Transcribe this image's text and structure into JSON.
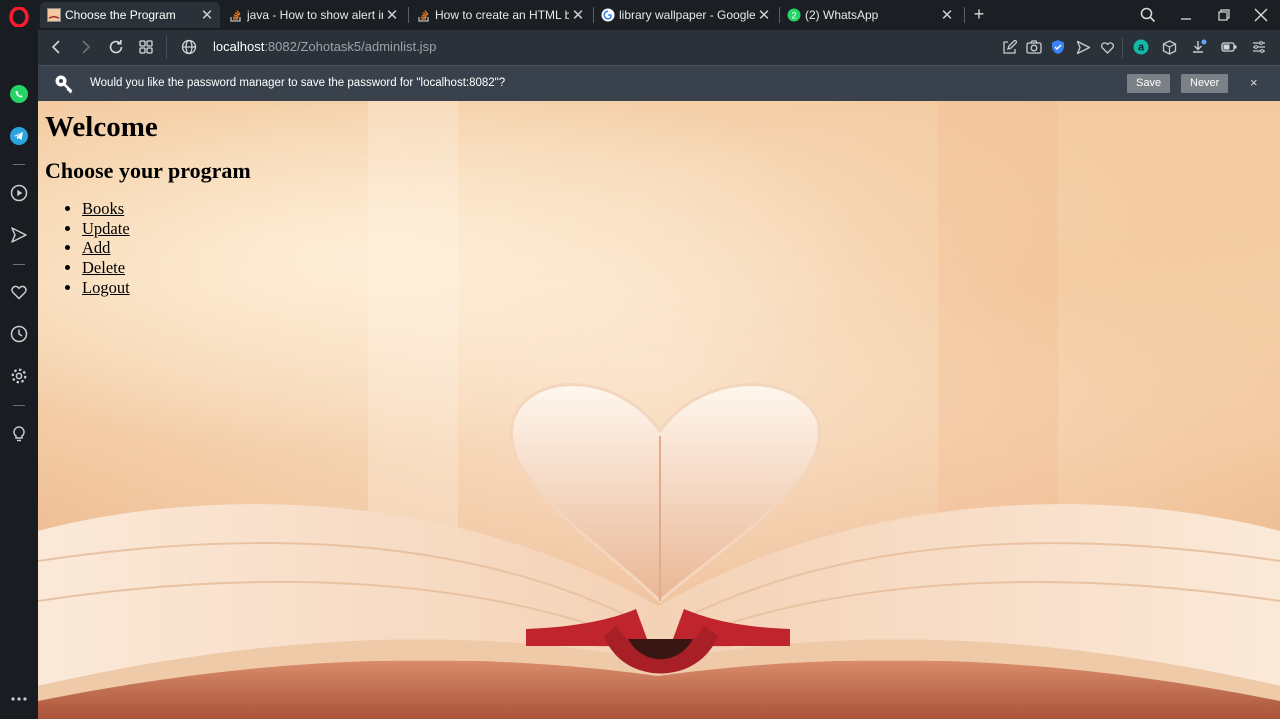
{
  "browser": {
    "tabs": [
      {
        "title": "Choose the Program",
        "favicon": "page-icon",
        "active": true
      },
      {
        "title": "java - How to show alert in",
        "favicon": "stackoverflow-icon",
        "active": false
      },
      {
        "title": "How to create an HTML bu",
        "favicon": "stackoverflow-icon",
        "active": false
      },
      {
        "title": "library wallpaper - Google",
        "favicon": "google-icon",
        "active": false
      },
      {
        "title": "(2) WhatsApp",
        "favicon": "whatsapp-icon",
        "active": false
      }
    ],
    "whatsapp_badge": "2",
    "address": {
      "host": "localhost",
      "rest": ":8082/Zohotask5/adminlist.jsp"
    },
    "password_bar": {
      "message": "Would you like the password manager to save the password for \"localhost:8082\"?",
      "save_label": "Save",
      "never_label": "Never",
      "close_label": "×"
    },
    "sidebar": [
      "whatsapp-icon",
      "telegram-icon",
      "player-icon",
      "send-icon",
      "heart-icon",
      "history-icon",
      "settings-icon",
      "lightbulb-icon",
      "more-icon"
    ]
  },
  "page": {
    "heading": "Welcome",
    "subheading": "Choose your program",
    "links": [
      {
        "label": "Books"
      },
      {
        "label": "Update"
      },
      {
        "label": "Add"
      },
      {
        "label": "Delete"
      },
      {
        "label": "Logout"
      }
    ]
  },
  "colors": {
    "chrome_dark": "#1b1f24",
    "toolbar": "#2b3138",
    "password_bar": "#39424c",
    "accent_blue": "#3b82f6",
    "whatsapp_green": "#25d366",
    "opera_red": "#ff1b2d"
  }
}
